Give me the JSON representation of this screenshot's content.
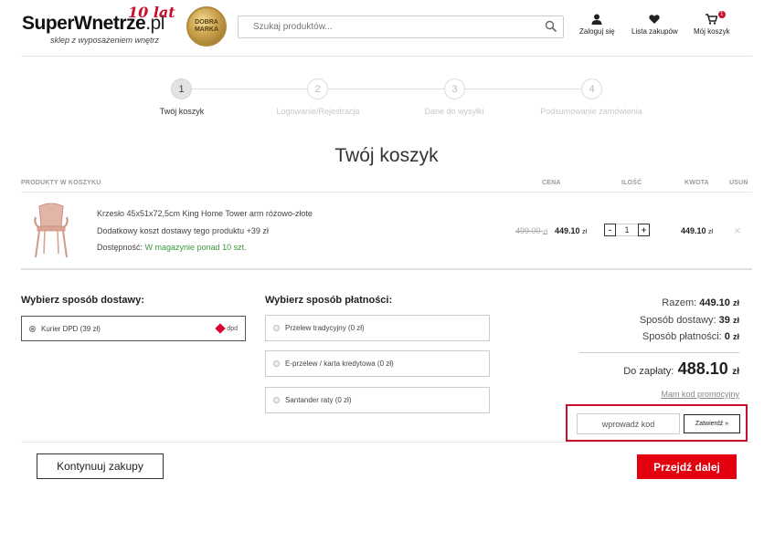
{
  "header": {
    "logo_main": "SuperWnetrze",
    "logo_tld": ".pl",
    "logo_tagline": "sklep z wyposażeniem wnętrz",
    "logo_anniversary": "10 lat",
    "medal_text": "DOBRA MARKA",
    "search_placeholder": "Szukaj produktów...",
    "links": {
      "login": "Zaloguj się",
      "wishlist": "Lista zakupów",
      "cart": "Mój koszyk"
    },
    "cart_count": "1"
  },
  "steps": [
    {
      "num": "1",
      "label": "Twój koszyk",
      "active": true
    },
    {
      "num": "2",
      "label": "Logowanie/Rejestracja",
      "active": false
    },
    {
      "num": "3",
      "label": "Dane do wysyłki",
      "active": false
    },
    {
      "num": "4",
      "label": "Podsumowanie zamówienia",
      "active": false
    }
  ],
  "page_title": "Twój koszyk",
  "table": {
    "headers": {
      "products": "PRODUKTY W KOSZYKU",
      "price": "CENA",
      "qty": "ILOŚĆ",
      "amount": "KWOTA",
      "remove": "USUŃ"
    },
    "item": {
      "name": "Krzesło 45x51x72,5cm King Home Tower arm różowo-złote",
      "extra_shipping": "Dodatkowy koszt dostawy tego produktu +39 zł",
      "availability_label": "Dostępność:",
      "availability_value": "W magazynie ponad 10 szt.",
      "old_price": "499.00",
      "new_price": "449.10",
      "currency": "zł",
      "qty": "1",
      "line_total": "449.10",
      "minus": "-",
      "plus": "+",
      "remove_symbol": "×"
    }
  },
  "delivery": {
    "title": "Wybierz sposób dostawy:",
    "options": [
      {
        "label": "Kurier DPD (39 zł)",
        "selected": true,
        "carrier": "dpd"
      }
    ]
  },
  "payment": {
    "title": "Wybierz sposób płatności:",
    "options": [
      {
        "label": "Przelew tradycyjny (0 zł)"
      },
      {
        "label": "E-przelew / karta kredytowa (0 zł)"
      },
      {
        "label": "Santander raty (0 zł)"
      }
    ]
  },
  "summary": {
    "subtotal_label": "Razem:",
    "subtotal_value": "449.10",
    "delivery_label": "Sposób dostawy:",
    "delivery_value": "39",
    "payment_label": "Sposób płatności:",
    "payment_value": "0",
    "currency": "zł",
    "total_label": "Do zapłaty:",
    "total_value": "488.10",
    "promo_link": "Mam kod promocyjny",
    "promo_placeholder": "wprowadź kod",
    "promo_button": "Zatwierdź »"
  },
  "buttons": {
    "continue": "Kontynuuj zakupy",
    "next": "Przejdź dalej"
  },
  "colors": {
    "brand_red": "#e3000f",
    "highlight_border": "#c8102e",
    "available_green": "#3a9a3a"
  }
}
